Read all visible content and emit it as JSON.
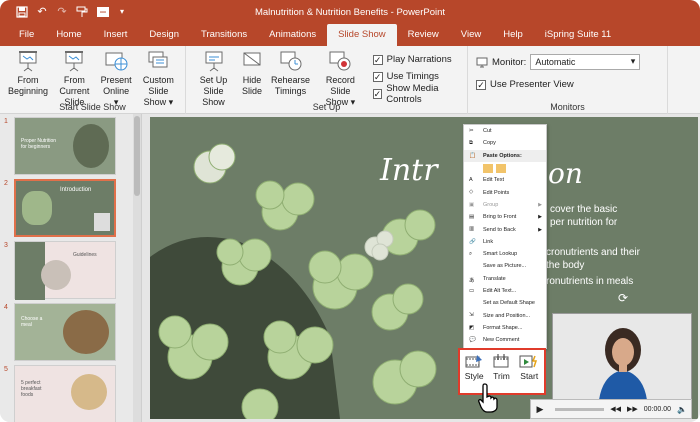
{
  "window": {
    "title": "Malnutrition & Nutrition Benefits  -  PowerPoint"
  },
  "qat": {
    "icons": [
      "save-icon",
      "undo-icon",
      "redo-icon",
      "format-painter-icon",
      "new-slide-icon",
      "customize-icon"
    ]
  },
  "tabs": [
    "File",
    "Home",
    "Insert",
    "Design",
    "Transitions",
    "Animations",
    "Slide Show",
    "Review",
    "View",
    "Help",
    "iSpring Suite 11"
  ],
  "active_tab": "Slide Show",
  "ribbon": {
    "start_group": {
      "label": "Start Slide Show",
      "buttons": [
        {
          "line1": "From",
          "line2": "Beginning"
        },
        {
          "line1": "From",
          "line2": "Current Slide"
        },
        {
          "line1": "Present",
          "line2": "Online ▾"
        },
        {
          "line1": "Custom Slide",
          "line2": "Show ▾"
        }
      ]
    },
    "setup_group": {
      "label": "Set Up",
      "buttons": [
        {
          "line1": "Set Up",
          "line2": "Slide Show"
        },
        {
          "line1": "Hide",
          "line2": "Slide"
        },
        {
          "line1": "Rehearse",
          "line2": "Timings"
        },
        {
          "line1": "Record Slide",
          "line2": "Show ▾"
        }
      ],
      "checks": [
        "Play Narrations",
        "Use Timings",
        "Show Media Controls"
      ]
    },
    "monitors_group": {
      "label": "Monitors",
      "monitor_label": "Monitor:",
      "monitor_value": "Automatic",
      "presenter_view": "Use Presenter View"
    }
  },
  "slides": [
    {
      "num": "1",
      "title": "Proper Nutrition for beginners"
    },
    {
      "num": "2",
      "title": "Introduction"
    },
    {
      "num": "3",
      "title": "Guidelines"
    },
    {
      "num": "4",
      "title": "Choose a meal"
    },
    {
      "num": "5",
      "title": "5 perfect breakfast foods"
    }
  ],
  "slide": {
    "title_part1": "Intr",
    "title_part2": "on",
    "bullets": [
      {
        "line1": "cover the basic",
        "line2": "per nutrition for"
      },
      {
        "line1": "cronutrients and their",
        "line2": "the body"
      },
      {
        "line1": "ronutrients in meals",
        "line2": ""
      }
    ]
  },
  "context_menu": {
    "items": [
      {
        "label": "Cut",
        "disabled": false
      },
      {
        "label": "Copy",
        "disabled": false
      },
      {
        "label": "Paste Options:",
        "header": true
      },
      {
        "label": "",
        "paste": true
      },
      {
        "label": "Edit Text",
        "disabled": false
      },
      {
        "label": "Edit Points",
        "disabled": false
      },
      {
        "label": "Group",
        "disabled": true,
        "sub": true
      },
      {
        "label": "Bring to Front",
        "disabled": false,
        "sub": true
      },
      {
        "label": "Send to Back",
        "disabled": false,
        "sub": true
      },
      {
        "label": "Link",
        "disabled": false
      },
      {
        "label": "Smart Lookup",
        "disabled": false
      },
      {
        "label": "Save as Picture...",
        "disabled": false
      },
      {
        "label": "Translate",
        "disabled": false
      },
      {
        "label": "Edit Alt Text...",
        "disabled": false
      },
      {
        "label": "Set as Default Shape",
        "disabled": false
      },
      {
        "label": "Size and Position...",
        "disabled": false
      },
      {
        "label": "Format Shape...",
        "disabled": false
      },
      {
        "label": "New Comment",
        "disabled": false
      }
    ]
  },
  "mini_toolbar": {
    "buttons": [
      "Style",
      "Trim",
      "Start"
    ]
  },
  "video": {
    "time": "00:00.00"
  }
}
